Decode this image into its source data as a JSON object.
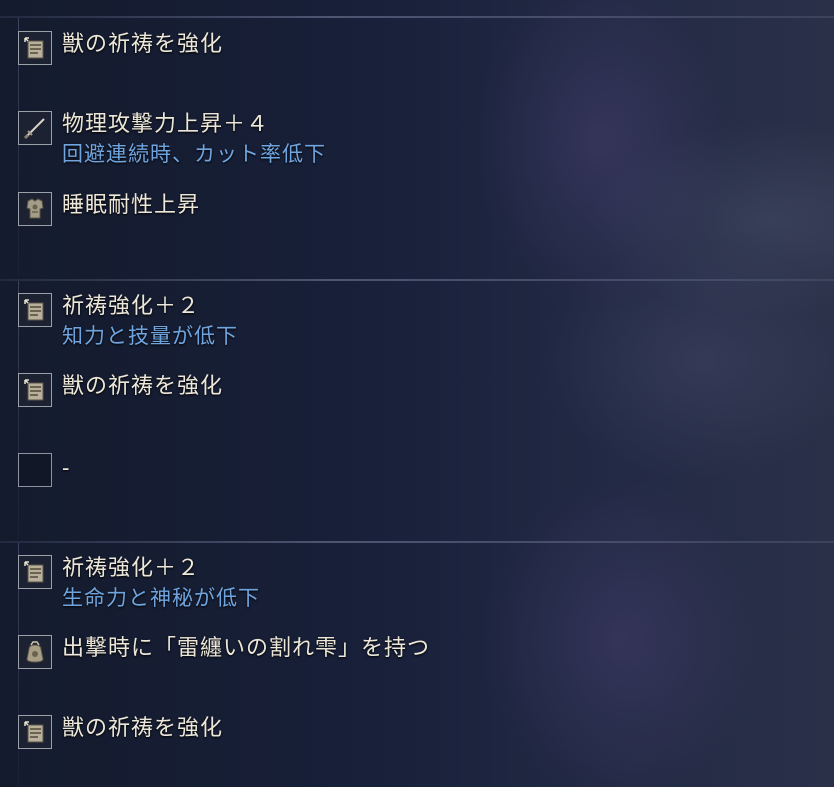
{
  "sections": [
    {
      "effects": [
        {
          "icon": "incantation-scroll-icon",
          "name": "獣の祈祷を強化"
        },
        {
          "icon": "sword-icon",
          "name": "物理攻撃力上昇＋４",
          "drawback": "回避連続時、カット率低下"
        },
        {
          "icon": "armor-icon",
          "name": "睡眠耐性上昇"
        }
      ]
    },
    {
      "effects": [
        {
          "icon": "incantation-scroll-icon",
          "name": "祈祷強化＋２",
          "drawback": "知力と技量が低下"
        },
        {
          "icon": "incantation-scroll-icon",
          "name": "獣の祈祷を強化"
        },
        {
          "icon": "empty-slot",
          "name": "-"
        }
      ]
    },
    {
      "effects": [
        {
          "icon": "incantation-scroll-icon",
          "name": "祈祷強化＋２",
          "drawback": "生命力と神秘が低下"
        },
        {
          "icon": "item-pouch-icon",
          "name": "出撃時に「雷纏いの割れ雫」を持つ"
        },
        {
          "icon": "incantation-scroll-icon",
          "name": "獣の祈祷を強化"
        }
      ]
    }
  ],
  "colors": {
    "effect_text": "#ece7d8",
    "drawback_text": "#6fa4de",
    "background": "#141b2c"
  }
}
